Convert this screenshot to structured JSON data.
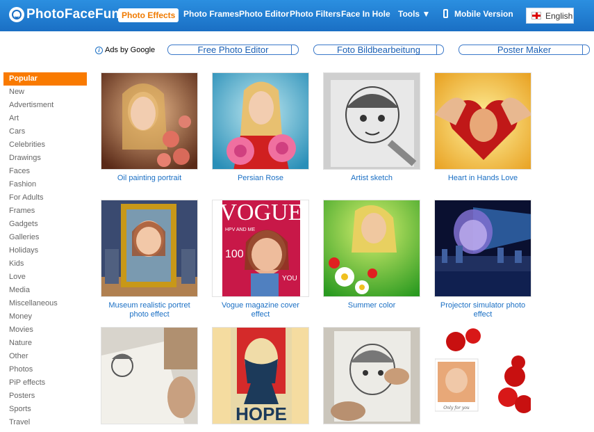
{
  "header": {
    "logo_text": "PhotoFaceFun",
    "nav": [
      {
        "label": "Photo Effects",
        "active": true
      },
      {
        "label": "Photo Frames"
      },
      {
        "label": "Photo Editor"
      },
      {
        "label": "Photo Filters"
      },
      {
        "label": "Face In Hole"
      },
      {
        "label": "Tools ▼"
      },
      {
        "label": "Mobile Version"
      }
    ],
    "language": "English"
  },
  "ads": {
    "label": "Ads by Google",
    "links": [
      "Free Photo Editor",
      "Foto Bildbearbeitung",
      "Poster Maker"
    ]
  },
  "sidebar": {
    "items": [
      "Popular",
      "New",
      "Advertisment",
      "Art",
      "Cars",
      "Celebrities",
      "Drawings",
      "Faces",
      "Fashion",
      "For Adults",
      "Frames",
      "Gadgets",
      "Galleries",
      "Holidays",
      "Kids",
      "Love",
      "Media",
      "Miscellaneous",
      "Money",
      "Movies",
      "Nature",
      "Other",
      "Photos",
      "PiP effects",
      "Posters",
      "Sports",
      "Travel"
    ],
    "active": "Popular"
  },
  "effects": [
    {
      "caption": "Oil painting portrait"
    },
    {
      "caption": "Persian Rose"
    },
    {
      "caption": "Artist sketch"
    },
    {
      "caption": "Heart in Hands Love"
    },
    {
      "caption": "Museum realistic portret photo effect"
    },
    {
      "caption": "Vogue magazine cover effect",
      "thumb_text": "VOGUE",
      "thumb_subtext": "HPV AND ME",
      "thumb_number": "100",
      "thumb_side": "YOU"
    },
    {
      "caption": "Summer color"
    },
    {
      "caption": "Projector simulator photo effect"
    },
    {
      "caption": ""
    },
    {
      "caption": "",
      "thumb_text": "HOPE"
    },
    {
      "caption": ""
    },
    {
      "caption": "",
      "thumb_text": "Only for you"
    }
  ],
  "colors": {
    "header": "#1a6fc4",
    "accent": "#f97a00",
    "link": "#1a6fc4"
  }
}
